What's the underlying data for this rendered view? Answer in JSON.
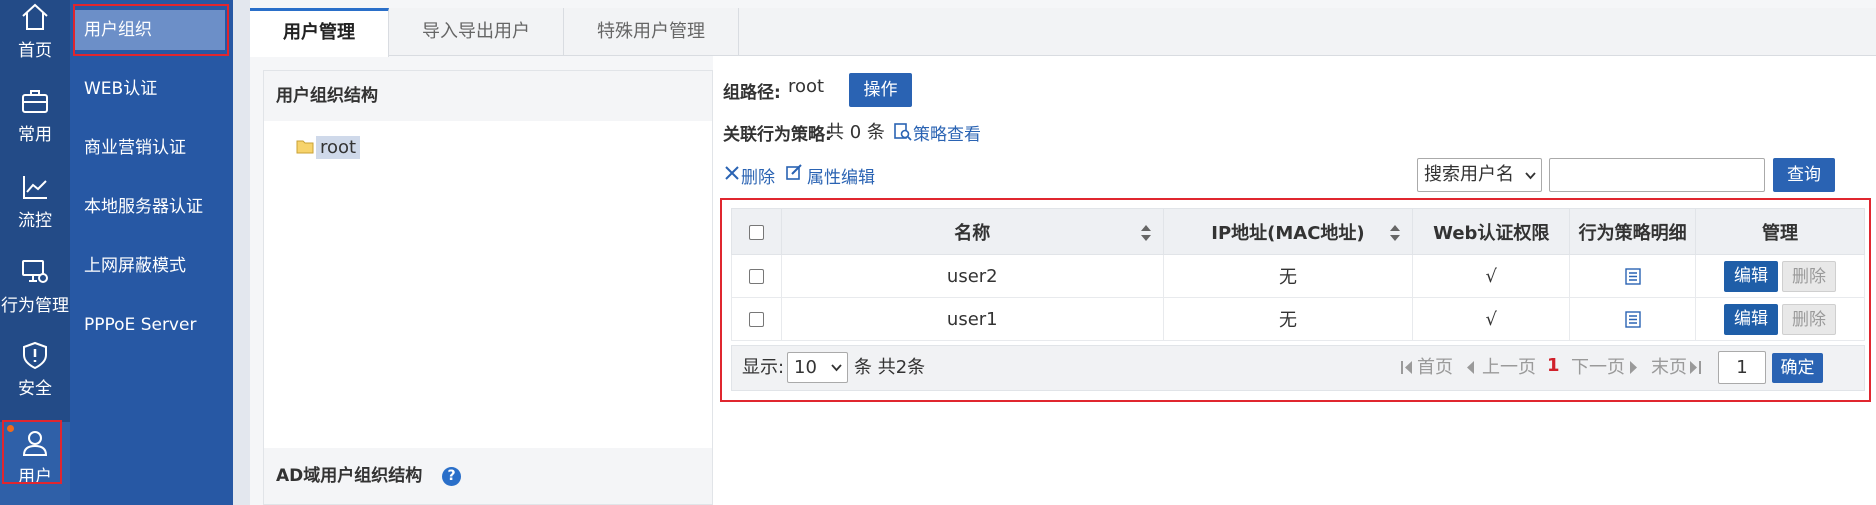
{
  "rail": {
    "items": [
      {
        "label": "首页",
        "icon": "home-icon"
      },
      {
        "label": "常用",
        "icon": "briefcase-icon"
      },
      {
        "label": "流控",
        "icon": "chart-icon"
      },
      {
        "label": "行为管理",
        "icon": "monitor-settings-icon"
      },
      {
        "label": "安全",
        "icon": "shield-icon"
      },
      {
        "label": "用户",
        "icon": "user-icon"
      }
    ]
  },
  "submenu": {
    "items": [
      "用户组织",
      "WEB认证",
      "商业营销认证",
      "本地服务器认证",
      "上网屏蔽模式",
      "PPPoE Server"
    ]
  },
  "tabs": [
    "用户管理",
    "导入导出用户",
    "特殊用户管理"
  ],
  "tree": {
    "heading": "用户组织结构",
    "root": "root",
    "ad_heading": "AD域用户组织结构",
    "help": "?"
  },
  "info": {
    "path_label": "组路径:",
    "path_value": "root",
    "operate_button": "操作",
    "policy_label": "关联行为策略:",
    "policy_value": "共 0 条",
    "policy_link": "策略查看"
  },
  "toolbar": {
    "delete": "删除",
    "edit_attr": "属性编辑",
    "search_select": "搜索用户名",
    "search_placeholder": "",
    "query_button": "查询"
  },
  "table": {
    "headers": [
      "名称",
      "IP地址(MAC地址)",
      "Web认证权限",
      "行为策略明细",
      "管理"
    ],
    "rows": [
      {
        "name": "user2",
        "ip": "无",
        "web": "√"
      },
      {
        "name": "user1",
        "ip": "无",
        "web": "√"
      }
    ],
    "edit_label": "编辑",
    "delete_label": "删除"
  },
  "pager": {
    "show_label": "显示:",
    "page_size": "10",
    "total": "条 共2条",
    "first": "首页",
    "prev": "上一页",
    "current": "1",
    "next": "下一页",
    "last": "末页",
    "goto_value": "1",
    "confirm": "确定"
  },
  "colors": {
    "rail_bg": "#234b87",
    "submenu_bg": "#2758a4",
    "primary": "#2a63b3",
    "highlight_border": "#e0262f"
  }
}
